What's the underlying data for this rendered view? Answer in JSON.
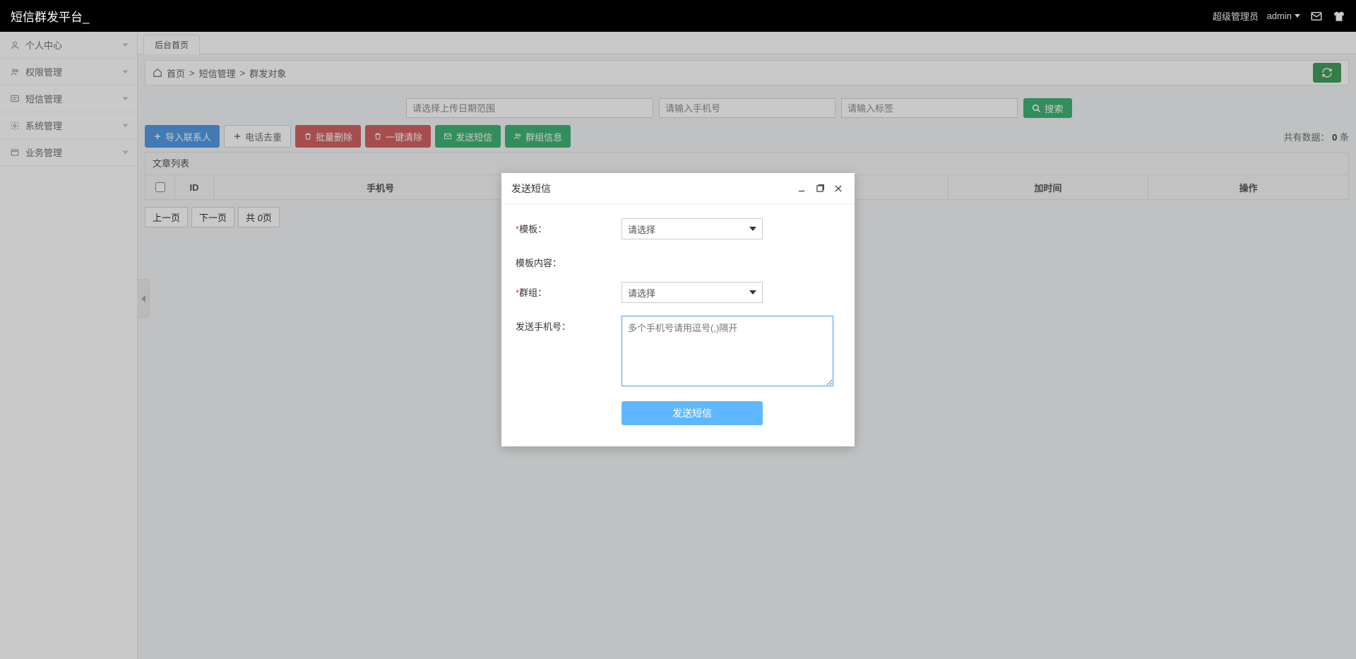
{
  "app": {
    "title": "短信群发平台_"
  },
  "header": {
    "role": "超级管理员",
    "user": "admin"
  },
  "sidebar": {
    "items": [
      {
        "label": "个人中心"
      },
      {
        "label": "权限管理"
      },
      {
        "label": "短信管理"
      },
      {
        "label": "系统管理"
      },
      {
        "label": "业务管理"
      }
    ]
  },
  "tabs": [
    {
      "label": "后台首页"
    }
  ],
  "breadcrumb": {
    "home": "首页",
    "part1": "短信管理",
    "part2": "群发对象"
  },
  "search": {
    "date_placeholder": "请选择上传日期范围",
    "phone_placeholder": "请输入手机号",
    "tag_placeholder": "请输入标签",
    "btn": "搜索"
  },
  "actions": {
    "import": "导入联系人",
    "dedup": "电话去重",
    "batch_del": "批量删除",
    "clear_all": "一键清除",
    "send_sms": "发送短信",
    "group_info": "群组信息"
  },
  "data_count": {
    "label": "共有数据：",
    "value": "0",
    "suffix": " 条"
  },
  "table": {
    "title": "文章列表",
    "cols": {
      "id": "ID",
      "phone": "手机号",
      "time_suffix": "加时间",
      "op": "操作"
    }
  },
  "pager": {
    "prev": "上一页",
    "next": "下一页",
    "total_prefix": "共 ",
    "total": "0",
    "total_suffix": "页"
  },
  "modal": {
    "title": "发送短信",
    "template_label": "模板：",
    "template_placeholder": "请选择",
    "content_label": "模板内容：",
    "group_label": "群组：",
    "group_placeholder": "请选择",
    "phone_label": "发送手机号：",
    "phone_placeholder": "多个手机号请用逗号(,)隔开",
    "submit": "发送短信"
  }
}
